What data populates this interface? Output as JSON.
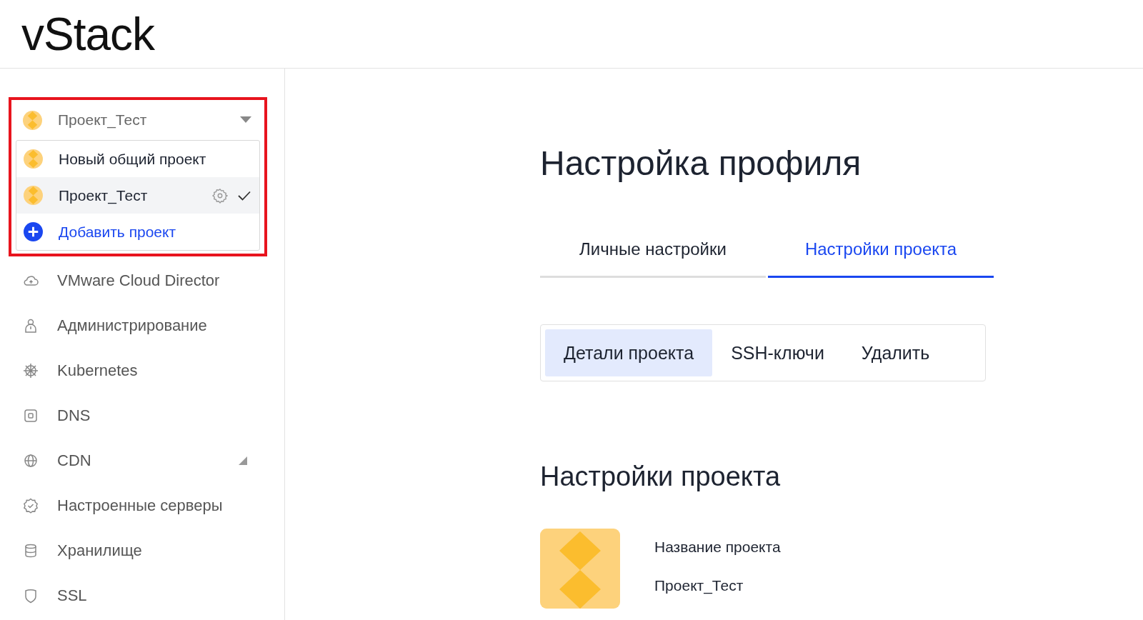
{
  "logo": "vStack",
  "project_selector": {
    "current": "Проект_Тест",
    "expanded": true,
    "projects": [
      {
        "name": "Новый общий проект",
        "selected": false
      },
      {
        "name": "Проект_Тест",
        "selected": true
      }
    ],
    "add_label": "Добавить проект"
  },
  "nav": [
    {
      "label": "VMware Cloud Director",
      "has_submenu": false
    },
    {
      "label": "Администрирование",
      "has_submenu": false
    },
    {
      "label": "Kubernetes",
      "has_submenu": false
    },
    {
      "label": "DNS",
      "has_submenu": false
    },
    {
      "label": "CDN",
      "has_submenu": true
    },
    {
      "label": "Настроенные серверы",
      "has_submenu": false
    },
    {
      "label": "Хранилище",
      "has_submenu": false
    },
    {
      "label": "SSL",
      "has_submenu": false
    }
  ],
  "page_title": "Настройка профиля",
  "tabs": [
    {
      "label": "Личные настройки",
      "selected": false
    },
    {
      "label": "Настройки проекта",
      "selected": true
    }
  ],
  "subtabs": [
    {
      "label": "Детали проекта",
      "selected": true
    },
    {
      "label": "SSH-ключи",
      "selected": false
    },
    {
      "label": "Удалить",
      "selected": false
    }
  ],
  "section_title": "Настройки проекта",
  "project": {
    "name_label": "Название проекта",
    "name": "Проект_Тест"
  }
}
